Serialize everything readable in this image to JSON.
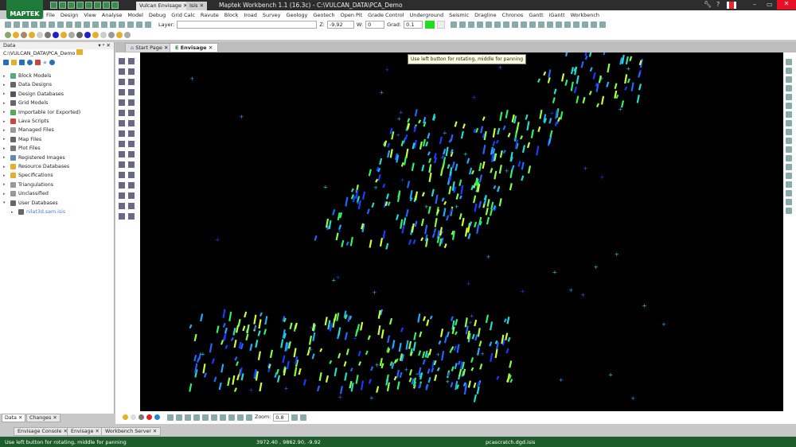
{
  "app": {
    "logo": "MAPTEK",
    "title": "Maptek Workbench 1.1 (16.3c) - C:\\VULCAN_DATA\\PCA_Demo",
    "window_tabs": [
      "Vulcan Envisage",
      "Isis"
    ]
  },
  "menu": [
    "File",
    "Design",
    "View",
    "Analyse",
    "Model",
    "Debug",
    "Grid Calc",
    "Ravute",
    "Block",
    "Iroad",
    "Survey",
    "Geology",
    "Geotech",
    "Open Pit",
    "Grade Control",
    "Underground",
    "Seismic",
    "Dragline",
    "Chronos",
    "Gantt",
    "iGantt",
    "Workbench"
  ],
  "toolbar": {
    "layer_label": "Layer:",
    "layer_value": "",
    "z_label": "Z:",
    "z_value": "-9.92",
    "w_label": "W:",
    "w_value": "0",
    "grad_label": "Grad:",
    "grad_value": "0.1",
    "grad_color": "#22dd22"
  },
  "left_panel": {
    "title": "Data",
    "path": "C:\\VULCAN_DATA\\PCA_Demo",
    "items": [
      {
        "label": "Block Models",
        "color": "#5a7"
      },
      {
        "label": "Data Designs",
        "color": "#666"
      },
      {
        "label": "Design Databases",
        "color": "#556"
      },
      {
        "label": "Grid Models",
        "color": "#666"
      },
      {
        "label": "Importable (or Exported)",
        "color": "#5a5"
      },
      {
        "label": "Lava Scripts",
        "color": "#c44"
      },
      {
        "label": "Managed Files",
        "color": "#999"
      },
      {
        "label": "Map Files",
        "color": "#666"
      },
      {
        "label": "Plot Files",
        "color": "#777"
      },
      {
        "label": "Registered Images",
        "color": "#68a"
      },
      {
        "label": "Resource Databases",
        "color": "#e4b02c"
      },
      {
        "label": "Specifications",
        "color": "#e4b02c"
      },
      {
        "label": "Triangulations",
        "color": "#999"
      },
      {
        "label": "Unclassified",
        "color": "#999"
      },
      {
        "label": "User Databases",
        "color": "#666"
      }
    ],
    "child": "nilat3d.sam.isis",
    "tabs": [
      "Data",
      "Changes"
    ]
  },
  "doc_tabs": [
    "Start Page",
    "Envisage"
  ],
  "tooltip": "Use left button for rotating, middle for panning",
  "bottom_toolbar": {
    "zoom_label": "Zoom:",
    "zoom_value": "0.8"
  },
  "lower_tabs": [
    "Envisage Console",
    "Envisage",
    "Workbench Server"
  ],
  "status": {
    "message": "Use left button for rotating, middle for panning",
    "coords": "3972.40 , 9862.90, -9.92",
    "file": "pcascratch.dgd.isis"
  }
}
